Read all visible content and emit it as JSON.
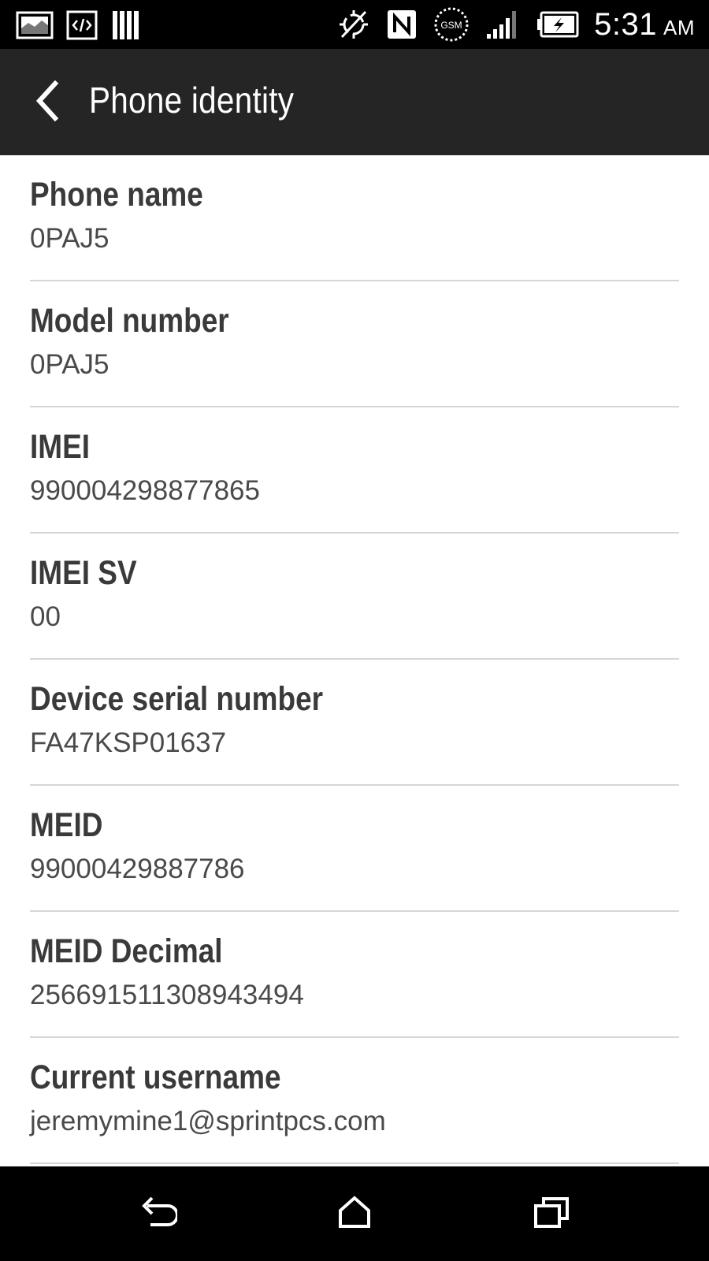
{
  "status_bar": {
    "time": "5:31",
    "ampm": "AM",
    "network_label": "GSM",
    "left_icons": [
      "gallery-notification-icon",
      "developer-code-icon",
      "barcode-notification-icon"
    ],
    "right_icons": [
      "sync-off-icon",
      "nfc-icon",
      "gsm-icon",
      "signal-strength-icon",
      "battery-charging-icon"
    ]
  },
  "app_bar": {
    "title": "Phone identity",
    "back_icon": "chevron-left-icon"
  },
  "items": [
    {
      "label": "Phone name",
      "value": "0PAJ5"
    },
    {
      "label": "Model number",
      "value": "0PAJ5"
    },
    {
      "label": "IMEI",
      "value": "990004298877865"
    },
    {
      "label": "IMEI SV",
      "value": "00"
    },
    {
      "label": "Device serial number",
      "value": "FA47KSP01637"
    },
    {
      "label": "MEID",
      "value": "99000429887786"
    },
    {
      "label": "MEID Decimal",
      "value": "256691511308943494"
    },
    {
      "label": "Current username",
      "value": "jeremymine1@sprintpcs.com"
    }
  ],
  "nav_bar": {
    "back_icon": "nav-back-icon",
    "home_icon": "home-icon",
    "recents_icon": "recent-apps-icon"
  },
  "colors": {
    "status_bar_bg": "#000000",
    "app_bar_bg": "#252525",
    "list_bg": "#ffffff",
    "label_text": "#3a3a3a",
    "value_text": "#4a4a4a",
    "divider": "#d6d6d6",
    "nav_bar_bg": "#000000"
  }
}
